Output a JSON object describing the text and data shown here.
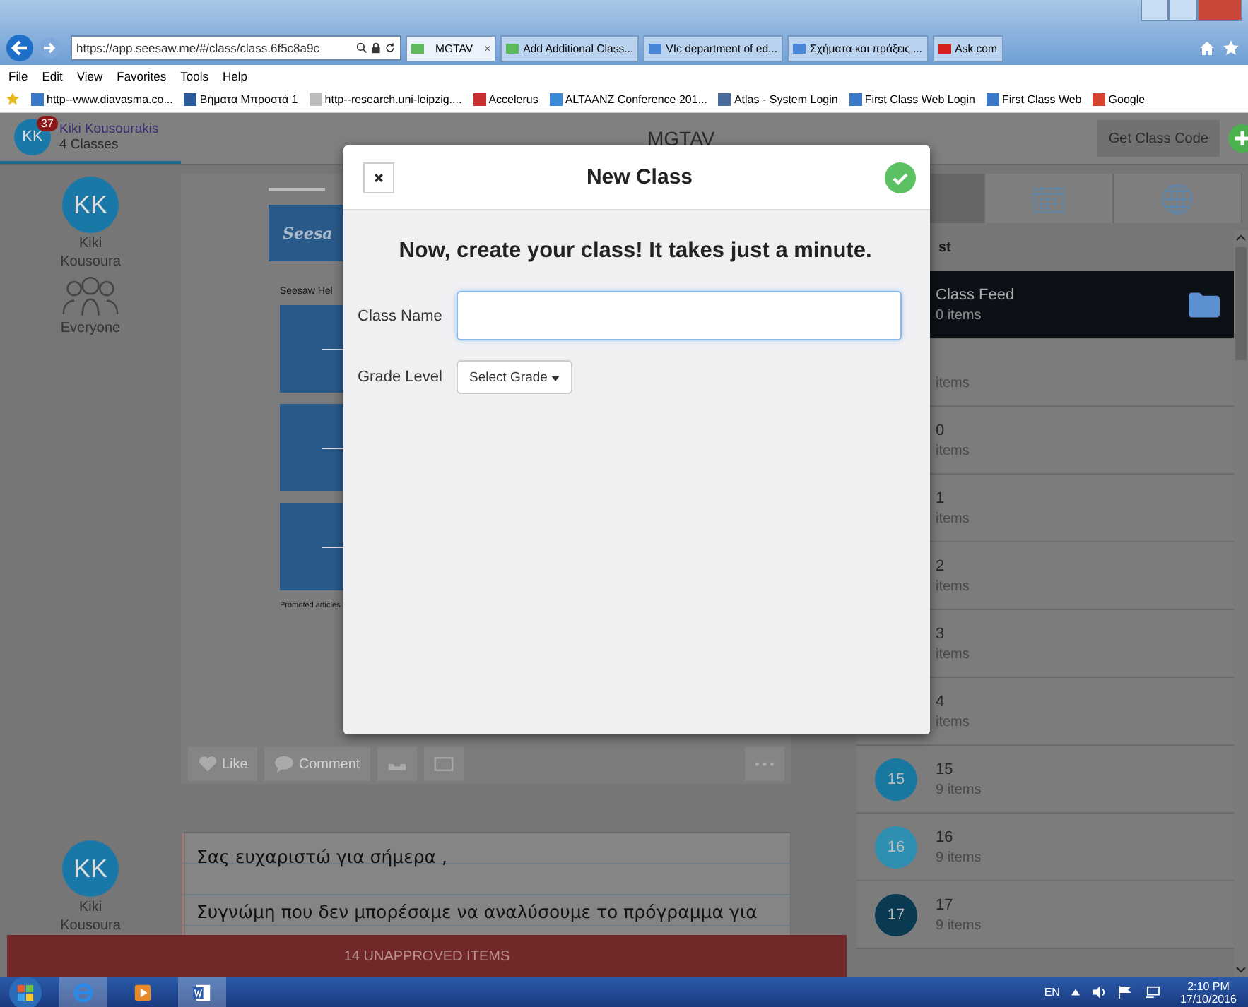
{
  "browser": {
    "address": "https://app.seesaw.me/#/class/class.6f5c8a9c",
    "tabs": [
      {
        "label": "MGTAV",
        "selected": true,
        "close": "×"
      },
      {
        "label": "Add Additional Class...",
        "selected": false
      },
      {
        "label": "VIc department of ed...",
        "selected": false
      },
      {
        "label": "Σχήματα και πράξεις ...",
        "selected": false
      },
      {
        "label": "Ask.com",
        "selected": false
      }
    ],
    "menu": [
      "File",
      "Edit",
      "View",
      "Favorites",
      "Tools",
      "Help"
    ],
    "favorites": [
      {
        "label": "http--www.diavasma.co...",
        "color": "#3a78c8"
      },
      {
        "label": "Βήματα Μπροστά 1",
        "color": "#2a5a9a"
      },
      {
        "label": "http--research.uni-leipzig....",
        "color": "#bbbbbb"
      },
      {
        "label": "Accelerus",
        "color": "#c83030"
      },
      {
        "label": "ALTAANZ Conference 201...",
        "color": "#3a8ad8"
      },
      {
        "label": "Atlas - System Login",
        "color": "#4a6a9a"
      },
      {
        "label": "First Class Web Login",
        "color": "#3a78c8"
      },
      {
        "label": "First Class Web",
        "color": "#3a78c8"
      },
      {
        "label": "Google",
        "color": "#d84030"
      }
    ]
  },
  "app": {
    "user": {
      "initials": "KK",
      "badge": "37",
      "name": "Kiki Kousourakis",
      "classes": "4 Classes"
    },
    "title": "MGTAV",
    "class_code_button": "Get Class Code"
  },
  "feed": [
    {
      "initials": "KK",
      "first": "Kiki",
      "last": "Kousoura",
      "group": "Everyone",
      "doc": {
        "banner": "Seesa",
        "heading": "Seesaw Hel",
        "footer": "Promoted articles"
      },
      "actions": [
        "Like",
        "Comment"
      ]
    },
    {
      "initials": "KK",
      "first": "Kiki",
      "last": "Kousoura",
      "lines": [
        "Σας ευχαριστώ για σήμερα ,",
        "Συγνώμη που δεν μπορέσαμε να αναλύσουμε το πρόγραμμα για"
      ]
    }
  ],
  "list": {
    "header": "st",
    "tabs": [
      {
        "selected": true
      },
      {
        "selected": false
      },
      {
        "selected": false
      }
    ],
    "rows": [
      {
        "title": "Class Feed",
        "count": "0 items",
        "selected": true
      },
      {
        "count": "items",
        "selected": false
      },
      {
        "title": "0",
        "count": "items",
        "selected": false
      },
      {
        "title": "1",
        "count": "items",
        "selected": false
      },
      {
        "title": "2",
        "count": "items",
        "selected": false
      },
      {
        "title": "3",
        "count": "items",
        "selected": false
      },
      {
        "title": "4",
        "count": "items",
        "selected": false
      },
      {
        "title": "15",
        "count": "9 items",
        "selected": false,
        "avatar": {
          "label": "15",
          "color": "#1878a0"
        }
      },
      {
        "title": "16",
        "count": "9 items",
        "selected": false,
        "avatar": {
          "label": "16",
          "color": "#2f8fb0"
        }
      },
      {
        "title": "17",
        "count": "9 items",
        "selected": false,
        "avatar": {
          "label": "17",
          "color": "#0a3a52"
        }
      }
    ]
  },
  "unapproved": "14 UNAPPROVED ITEMS",
  "modal": {
    "title": "New Class",
    "heading": "Now, create your class! It takes just a minute.",
    "fields": [
      {
        "kind": "text",
        "label": "Class Name"
      },
      {
        "kind": "select",
        "label": "Grade Level",
        "value": "Select Grade"
      }
    ]
  },
  "taskbar": {
    "language": "EN",
    "time": "2:10 PM",
    "date": "17/10/2016"
  }
}
